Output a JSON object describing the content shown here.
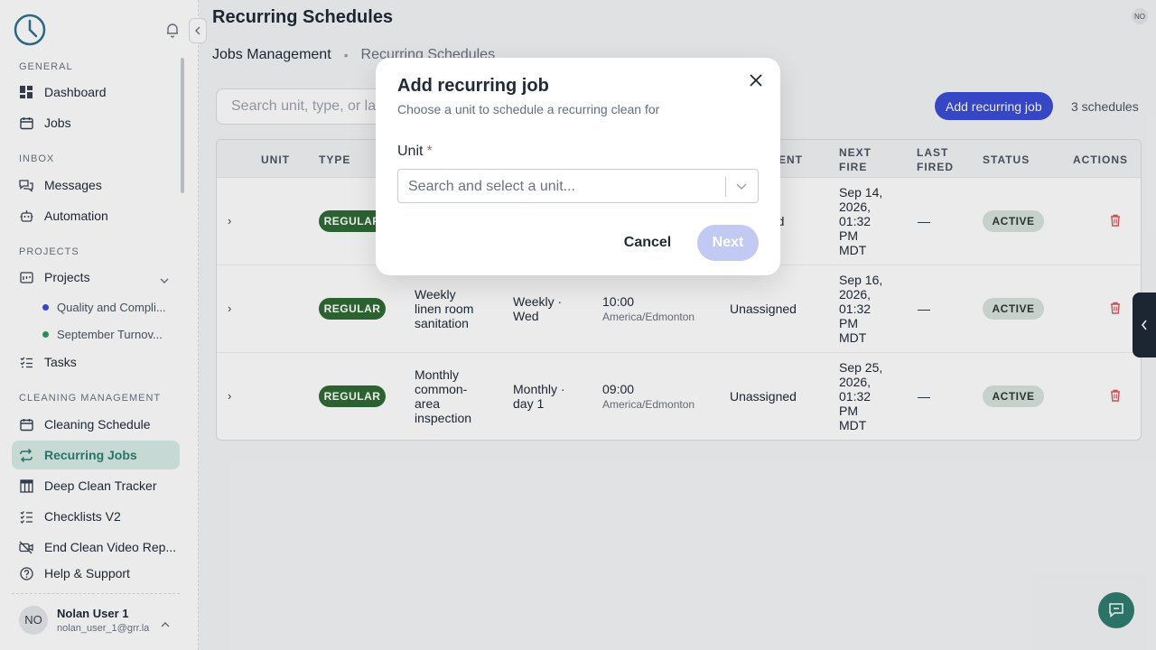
{
  "sidebar": {
    "sections": {
      "general": "GENERAL",
      "inbox": "INBOX",
      "projects": "PROJECTS",
      "cleaning": "CLEANING MANAGEMENT"
    },
    "items": {
      "dashboard": "Dashboard",
      "jobs": "Jobs",
      "messages": "Messages",
      "automation": "Automation",
      "projects": "Projects",
      "tasks": "Tasks",
      "cleaning_schedule": "Cleaning Schedule",
      "recurring_jobs": "Recurring Jobs",
      "deep_clean": "Deep Clean Tracker",
      "checklists": "Checklists V2",
      "end_clean_video": "End Clean Video Rep...",
      "help": "Help & Support"
    },
    "subprojects": [
      {
        "label": "Quality and Compli...",
        "color": "#3b4ed6"
      },
      {
        "label": "September Turnov...",
        "color": "#2f9a5a"
      }
    ],
    "user": {
      "initials": "NO",
      "name": "Nolan User 1",
      "email": "nolan_user_1@grr.la"
    }
  },
  "header": {
    "title": "Recurring Schedules",
    "avatar_initials": "NO"
  },
  "tabs": {
    "first": "Jobs Management",
    "separator": "•",
    "second": "Recurring Schedules"
  },
  "toolbar": {
    "search_placeholder": "Search unit, type, or la",
    "add_button": "Add recurring job",
    "count": "3 schedules"
  },
  "table": {
    "headers": {
      "unit": "UNIT",
      "type": "TYPE",
      "assignment": "MENT",
      "next_fire_1": "NEXT",
      "next_fire_2": "FIRE",
      "last_fired_1": "LAST",
      "last_fired_2": "FIRED",
      "status": "STATUS",
      "actions": "ACTIONS"
    },
    "rows": [
      {
        "type": "REGULAR",
        "name": [
          "",
          "",
          ""
        ],
        "frequency": [
          "",
          ""
        ],
        "time": "",
        "timezone": "",
        "assignee": "ned",
        "next_fire": [
          "Sep 14,",
          "2026,",
          "01:32",
          "PM",
          "MDT"
        ],
        "last_fired": "—",
        "status": "ACTIVE"
      },
      {
        "type": "REGULAR",
        "name": [
          "Weekly",
          "linen room",
          "sanitation"
        ],
        "frequency": [
          "Weekly ·",
          "Wed"
        ],
        "time": "10:00",
        "timezone": "America/Edmonton",
        "assignee": "Unassigned",
        "next_fire": [
          "Sep 16,",
          "2026,",
          "01:32",
          "PM",
          "MDT"
        ],
        "last_fired": "—",
        "status": "ACTIVE"
      },
      {
        "type": "REGULAR",
        "name": [
          "Monthly",
          "common-",
          "area",
          "inspection"
        ],
        "frequency": [
          "Monthly ·",
          "day 1"
        ],
        "time": "09:00",
        "timezone": "America/Edmonton",
        "assignee": "Unassigned",
        "next_fire": [
          "Sep 25,",
          "2026,",
          "01:32",
          "PM",
          "MDT"
        ],
        "last_fired": "—",
        "status": "ACTIVE"
      }
    ]
  },
  "modal": {
    "title": "Add recurring job",
    "subtitle": "Choose a unit to schedule a recurring clean for",
    "field_label": "Unit",
    "required_mark": "*",
    "select_placeholder": "Search and select a unit...",
    "cancel": "Cancel",
    "next": "Next"
  },
  "colors": {
    "accent": "#3b4ed6",
    "teal": "#2f7d6f",
    "regular_badge": "#2f6b34",
    "delete": "#e0565b"
  }
}
